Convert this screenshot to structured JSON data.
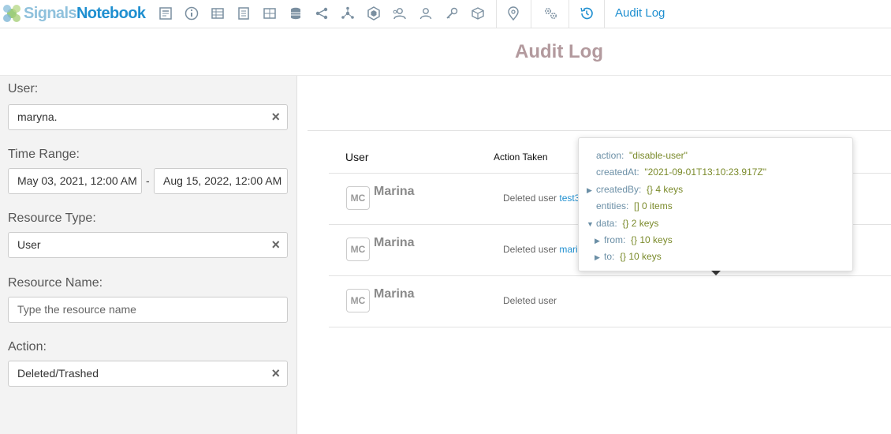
{
  "app": {
    "logo_signals": "Signals",
    "logo_notebook": "Notebook",
    "breadcrumb": "Audit Log"
  },
  "toolbar_icons": [
    "notebook-icon",
    "info-icon",
    "table-icon",
    "document-icon",
    "grid-icon",
    "database-icon",
    "share-icon",
    "network-icon",
    "hexagon-icon",
    "group-icon",
    "user-icon",
    "key-icon",
    "cube-icon",
    "location-pin-icon",
    "settings-gears-icon",
    "history-icon"
  ],
  "page": {
    "title": "Audit Log"
  },
  "filters": {
    "user_label": "User:",
    "user_value": "maryna.",
    "time_label": "Time Range:",
    "time_from": "May 03, 2021, 12:00 AM",
    "time_to": "Aug 15, 2022, 12:00 AM",
    "time_sep": "-",
    "resource_type_label": "Resource Type:",
    "resource_type_value": "User",
    "resource_name_label": "Resource Name:",
    "resource_name_placeholder": "Type the resource name",
    "action_label": "Action:",
    "action_value": "Deleted/Trashed",
    "clear_symbol": "×"
  },
  "table": {
    "columns": {
      "user": "User",
      "action": "Action Taken"
    },
    "rows": [
      {
        "initials": "MC",
        "name": "Marina",
        "action_text": "Deleted user",
        "link": "test3"
      },
      {
        "initials": "MC",
        "name": "Marina",
        "action_text": "Deleted user",
        "link": "mari"
      },
      {
        "initials": "MC",
        "name": "Marina",
        "action_text": "Deleted user",
        "link": ""
      }
    ]
  },
  "popover": {
    "action_key": "action:",
    "action_val": "\"disable-user\"",
    "created_at_key": "createdAt:",
    "created_at_val": "\"2021-09-01T13:10:23.917Z\"",
    "created_by_key": "createdBy:",
    "created_by_val": "{}  4 keys",
    "entities_key": "entities:",
    "entities_val": "[]  0 items",
    "data_key": "data:",
    "data_val": "{}  2 keys",
    "from_key": "from:",
    "from_val": "{}  10 keys",
    "to_key": "to:",
    "to_val": "{}  10 keys",
    "collapsed_marker": "▶",
    "expanded_marker": "▼"
  },
  "colors": {
    "accent": "#1f8fd0",
    "title": "#b39a9e",
    "json_value": "#7a8a2a",
    "json_key": "#6b8fa6"
  }
}
